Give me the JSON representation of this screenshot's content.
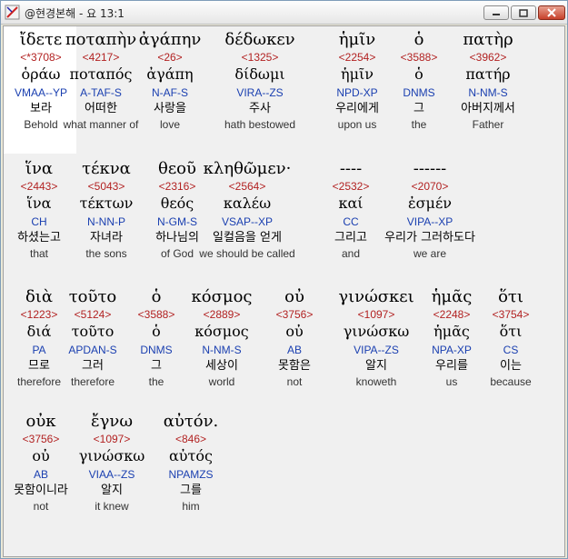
{
  "window": {
    "title": "@현경본해 - 요 13:1",
    "colors": {
      "strong": "#b22222",
      "parse": "#1a3fb0",
      "close": "#c7402a"
    }
  },
  "words": [
    {
      "greek": "ἴδετε",
      "strong": "<*3708>",
      "lemma": "ὁράω",
      "parse": "VMAA--YP",
      "korean": "보라",
      "english": "Behold"
    },
    {
      "greek": "ποταπὴν",
      "strong": "<4217>",
      "lemma": "ποταπός",
      "parse": "A-TAF-S",
      "korean": "어떠한",
      "english": "what manner of"
    },
    {
      "greek": "ἀγάπην",
      "strong": "<26>",
      "lemma": "ἀγάπη",
      "parse": "N-AF-S",
      "korean": "사랑을",
      "english": "love"
    },
    {
      "greek": "δέδωκεν",
      "strong": "<1325>",
      "lemma": "δίδωμι",
      "parse": "VIRA--ZS",
      "korean": "주사",
      "english": "hath bestowed"
    },
    {
      "greek": "ἡμῖν",
      "strong": "<2254>",
      "lemma": "ἡμῖν",
      "parse": "NPD-XP",
      "korean": "우리에게",
      "english": "upon us"
    },
    {
      "greek": "ὁ",
      "strong": "<3588>",
      "lemma": "ὁ",
      "parse": "DNMS",
      "korean": "그",
      "english": "the"
    },
    {
      "greek": "πατὴρ",
      "strong": "<3962>",
      "lemma": "πατήρ",
      "parse": "N-NM-S",
      "korean": "아버지께서",
      "english": "Father"
    },
    {
      "greek": "ἵνα",
      "strong": "<2443>",
      "lemma": "ἵνα",
      "parse": "CH",
      "korean": "하셨는고",
      "english": "that"
    },
    {
      "greek": "τέκνα",
      "strong": "<5043>",
      "lemma": "τέκτων",
      "parse": "N-NN-P",
      "korean": "자녀라",
      "english": "the sons"
    },
    {
      "greek": "θεοῦ",
      "strong": "<2316>",
      "lemma": "θεός",
      "parse": "N-GM-S",
      "korean": "하나님의",
      "english": "of God"
    },
    {
      "greek": "κληθῶμεν·",
      "strong": "<2564>",
      "lemma": "καλέω",
      "parse": "VSAP--XP",
      "korean": "일컬음을 얻게",
      "english": "we should be called"
    },
    {
      "greek": "----",
      "strong": "<2532>",
      "lemma": "καί",
      "parse": "CC",
      "korean": "그리고",
      "english": "and"
    },
    {
      "greek": "------",
      "strong": "<2070>",
      "lemma": "ἐσμέν",
      "parse": "VIPA--XP",
      "korean": "우리가 그러하도다",
      "english": "we are"
    },
    {
      "greek": "διὰ",
      "strong": "<1223>",
      "lemma": "διά",
      "parse": "PA",
      "korean": "므로",
      "english": "therefore"
    },
    {
      "greek": "τοῦτο",
      "strong": "<5124>",
      "lemma": "τοῦτο",
      "parse": "APDAN-S",
      "korean": "그러",
      "english": "therefore"
    },
    {
      "greek": "ὁ",
      "strong": "<3588>",
      "lemma": "ὁ",
      "parse": "DNMS",
      "korean": "그",
      "english": "the"
    },
    {
      "greek": "κόσμος",
      "strong": "<2889>",
      "lemma": "κόσμος",
      "parse": "N-NM-S",
      "korean": "세상이",
      "english": "world"
    },
    {
      "greek": "οὐ",
      "strong": "<3756>",
      "lemma": "οὐ",
      "parse": "AB",
      "korean": "못함은",
      "english": "not"
    },
    {
      "greek": "γινώσκει",
      "strong": "<1097>",
      "lemma": "γινώσκω",
      "parse": "VIPA--ZS",
      "korean": "알지",
      "english": "knoweth"
    },
    {
      "greek": "ἡμᾶς",
      "strong": "<2248>",
      "lemma": "ἡμᾶς",
      "parse": "NPA-XP",
      "korean": "우리를",
      "english": "us"
    },
    {
      "greek": "ὅτι",
      "strong": "<3754>",
      "lemma": "ὅτι",
      "parse": "CS",
      "korean": "이는",
      "english": "because"
    },
    {
      "greek": "οὐκ",
      "strong": "<3756>",
      "lemma": "οὐ",
      "parse": "AB",
      "korean": "못함이니라",
      "english": "not"
    },
    {
      "greek": "ἔγνω",
      "strong": "<1097>",
      "lemma": "γινώσκω",
      "parse": "VIAA--ZS",
      "korean": "알지",
      "english": "it knew"
    },
    {
      "greek": "αὐτόν.",
      "strong": "<846>",
      "lemma": "αὐτός",
      "parse": "NPAMZS",
      "korean": "그를",
      "english": "him"
    }
  ]
}
